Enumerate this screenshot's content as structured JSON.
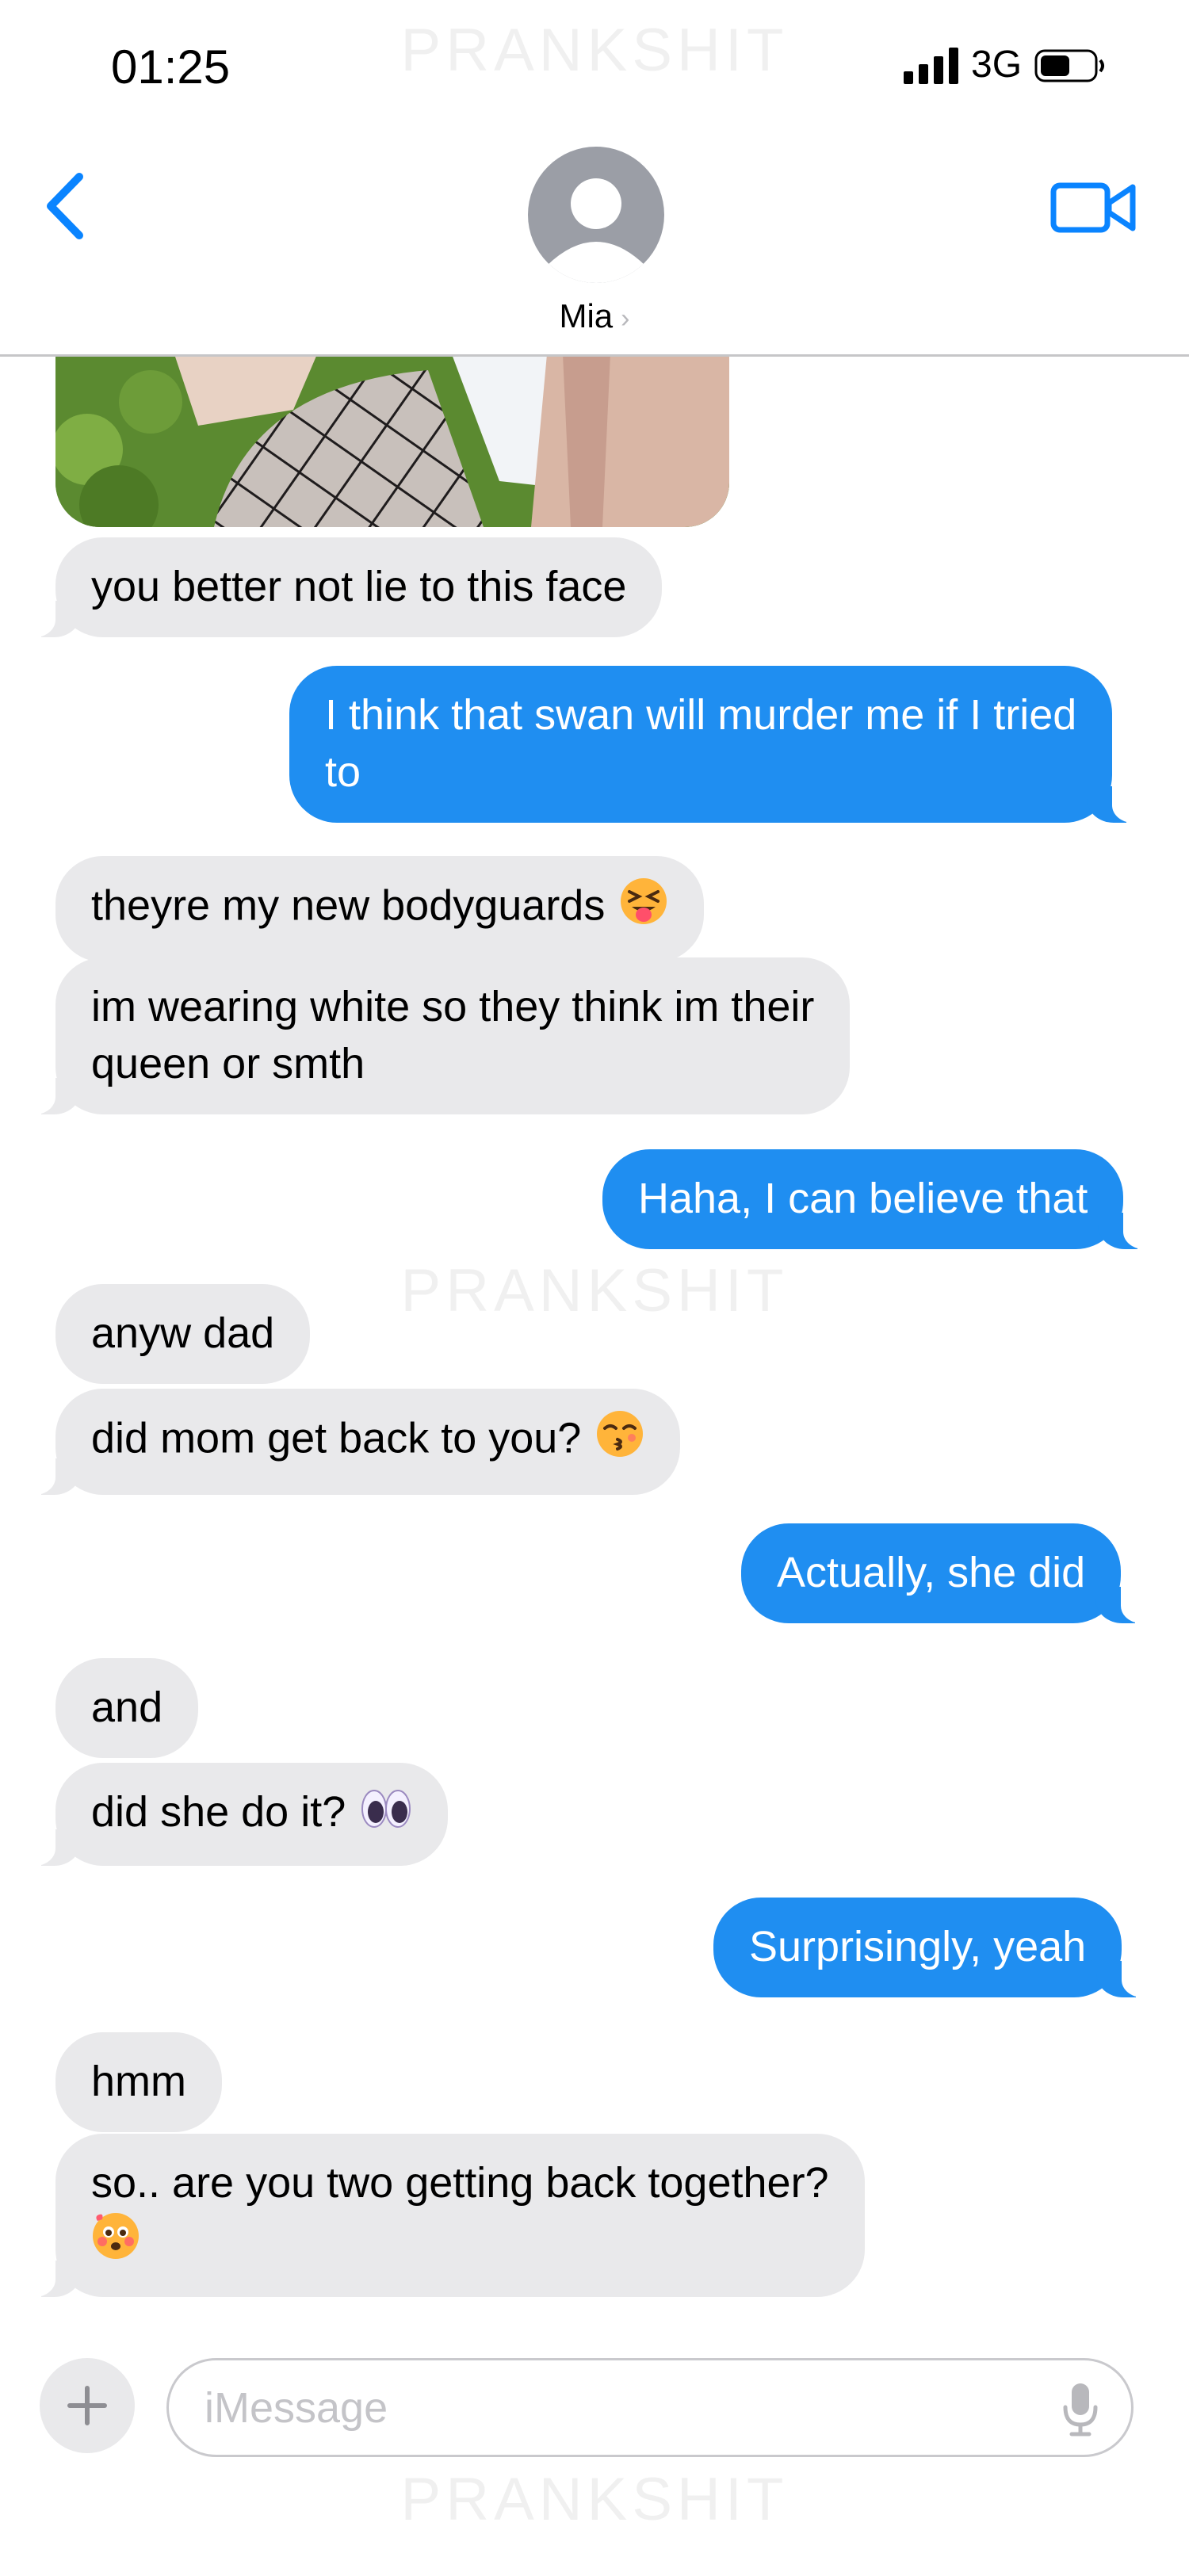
{
  "watermark": "PRANKSHIT",
  "status_bar": {
    "time": "01:25",
    "network": "3G"
  },
  "header": {
    "contact_name": "Mia"
  },
  "messages": [
    {
      "dir": "in",
      "lines": [
        "you better not lie to this face"
      ]
    },
    {
      "dir": "out",
      "lines": [
        "I think that swan will murder me if I tried",
        "to"
      ]
    },
    {
      "dir": "in",
      "lines": [
        "theyre my new bodyguards"
      ],
      "emoji": "squinting-tongue-emoji"
    },
    {
      "dir": "in",
      "lines": [
        "im wearing white so they think im their",
        "queen or smth"
      ]
    },
    {
      "dir": "out",
      "lines": [
        "Haha, I can believe that"
      ]
    },
    {
      "dir": "in",
      "lines": [
        "anyw dad"
      ]
    },
    {
      "dir": "in",
      "lines": [
        "did mom get back to you?"
      ],
      "emoji": "kissing-emoji"
    },
    {
      "dir": "out",
      "lines": [
        "Actually, she did"
      ]
    },
    {
      "dir": "in",
      "lines": [
        "and"
      ]
    },
    {
      "dir": "in",
      "lines": [
        "did she do it?"
      ],
      "emoji": "eyes-emoji"
    },
    {
      "dir": "out",
      "lines": [
        "Surprisingly, yeah"
      ]
    },
    {
      "dir": "in",
      "lines": [
        "hmm"
      ]
    },
    {
      "dir": "in",
      "lines": [
        "so.. are you two getting back together?"
      ],
      "emoji": "flushed-emoji"
    }
  ],
  "input": {
    "placeholder": "iMessage"
  },
  "colors": {
    "accent": "#1f8ef1",
    "incoming_bubble": "#e9e9eb",
    "ios_blue": "#0a84ff"
  }
}
